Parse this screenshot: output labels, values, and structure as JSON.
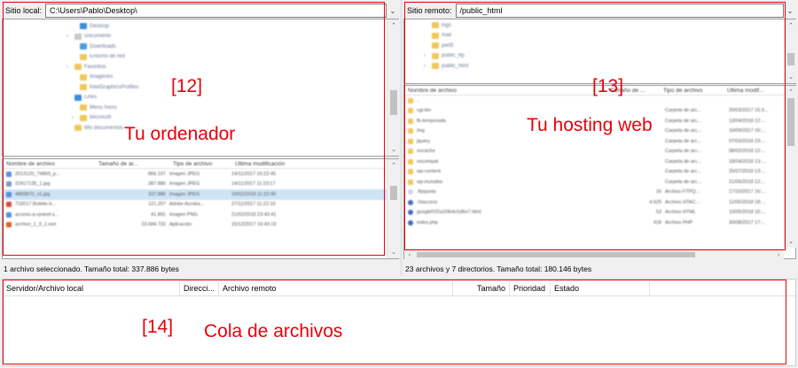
{
  "local": {
    "label": "Sitio local:",
    "path": "C:\\Users\\Pablo\\Desktop\\",
    "tree": [
      {
        "name": "Desktop",
        "indent": 2,
        "icon": "#3a8de0"
      },
      {
        "name": "Documents",
        "indent": 2,
        "icon": "#c9c9c9"
      },
      {
        "name": "Downloads",
        "indent": 2,
        "icon": "#4a9be6"
      },
      {
        "name": "Entorno de red",
        "indent": 2,
        "icon": "#f1c75a"
      },
      {
        "name": "Favoritos",
        "indent": 2,
        "icon": "#f1c75a"
      },
      {
        "name": "Imagenes",
        "indent": 2,
        "icon": "#f1c75a"
      },
      {
        "name": "IntelGraphicsProfiles",
        "indent": 2,
        "icon": "#f1c75a"
      },
      {
        "name": "Links",
        "indent": 2,
        "icon": "#3a8de0"
      },
      {
        "name": "Menu Inicio",
        "indent": 2,
        "icon": "#f1c75a"
      },
      {
        "name": "Microsoft",
        "indent": 2,
        "icon": "#f1c75a"
      },
      {
        "name": "Mis documentos",
        "indent": 2,
        "icon": "#f1c75a"
      }
    ],
    "columns": [
      "Nombre de archivo",
      "Tamaño de ar...",
      "Tipo de archivo",
      "Última modificación"
    ],
    "files": [
      [
        "2013120_74869_p...",
        "866.197",
        "Imagen JPEG",
        "14/11/2017 16:22:45"
      ],
      [
        "22417135_1.jpg",
        "387.886",
        "Imagen JPEG",
        "14/11/2017 11:23:17"
      ],
      [
        "4883870_n1.jpg",
        "337.886",
        "Imagen JPEG",
        "19/02/2018 11:22:40"
      ],
      [
        "718217 Boletin-Ir...",
        "121.207",
        "Adobe Acroba...",
        "27/11/2017 11:22:16"
      ],
      [
        "acceso-a-cpanel-s...",
        "41.891",
        "Imagen PNG",
        "21/02/2018 23:43:41"
      ],
      [
        "archivo_1_0_1.exe",
        "23.684.732",
        "Aplicación",
        "15/12/2017 16:43:19"
      ]
    ],
    "file_icons": [
      "#5a8fd8",
      "#7a9ac0",
      "#5a8fd8",
      "#d94b3a",
      "#5a8fd8",
      "#d9622a"
    ],
    "status": "1 archivo seleccionado. Tamaño total: 337.886 bytes"
  },
  "remote": {
    "label": "Sitio remoto:",
    "path": "/public_html",
    "tree": [
      {
        "name": "logs",
        "indent": 3
      },
      {
        "name": "mail",
        "indent": 3
      },
      {
        "name": "perl5",
        "indent": 3
      },
      {
        "name": "public_ftp",
        "indent": 3
      },
      {
        "name": "public_html",
        "indent": 3
      }
    ],
    "columns": [
      "Nombre de archivo",
      "Tamaño de ...",
      "Tipo de archivo",
      "Última modif..."
    ],
    "files": [
      [
        "..",
        "",
        "",
        ""
      ],
      [
        "cgi-bin",
        "",
        "Carpeta de arc...",
        "20/03/2017 15:3..."
      ],
      [
        "fb-temporada",
        "",
        "Carpeta de arc...",
        "13/04/2018 12:..."
      ],
      [
        "img",
        "",
        "Carpeta de arc...",
        "10/09/2017 16:..."
      ],
      [
        "jquery",
        "",
        "Carpeta de arc...",
        "07/03/2018 23:..."
      ],
      [
        "nocache",
        "",
        "Carpeta de arc...",
        "08/02/2018 12:..."
      ],
      [
        "nocompat",
        "",
        "Carpeta de arc...",
        "18/04/2018 13:..."
      ],
      [
        "wp-content",
        "",
        "Carpeta de arc...",
        "25/07/2018 13:..."
      ],
      [
        "wp-includes",
        "",
        "Carpeta de arc...",
        "21/06/2018 12:..."
      ],
      [
        ".ftpquota",
        "16",
        "Archivo FTPQ...",
        "17/10/2017 16:..."
      ],
      [
        ".htaccess",
        "4.625",
        "Archivo HTAC...",
        "12/05/2018 18:..."
      ],
      [
        "googlef1f2a1f3b4c5d6e7.html",
        "53",
        "Archivo HTML",
        "10/05/2018 16:..."
      ],
      [
        "index.php",
        "418",
        "Archivo PHP",
        "30/08/2017 17:..."
      ]
    ],
    "status": "23 archivos y 7 directorios. Tamaño total: 180.146 bytes"
  },
  "queue": {
    "columns": [
      "Servidor/Archivo local",
      "Direcci...",
      "Archivo remoto",
      "Tamaño",
      "Prioridad",
      "Estado"
    ]
  },
  "annotations": {
    "local_num": "[12]",
    "local_text": "Tu ordenador",
    "remote_num": "[13]",
    "remote_text": "Tu hosting web",
    "queue_num": "[14]",
    "queue_text": "Cola de archivos",
    "color": "#e8000b"
  }
}
